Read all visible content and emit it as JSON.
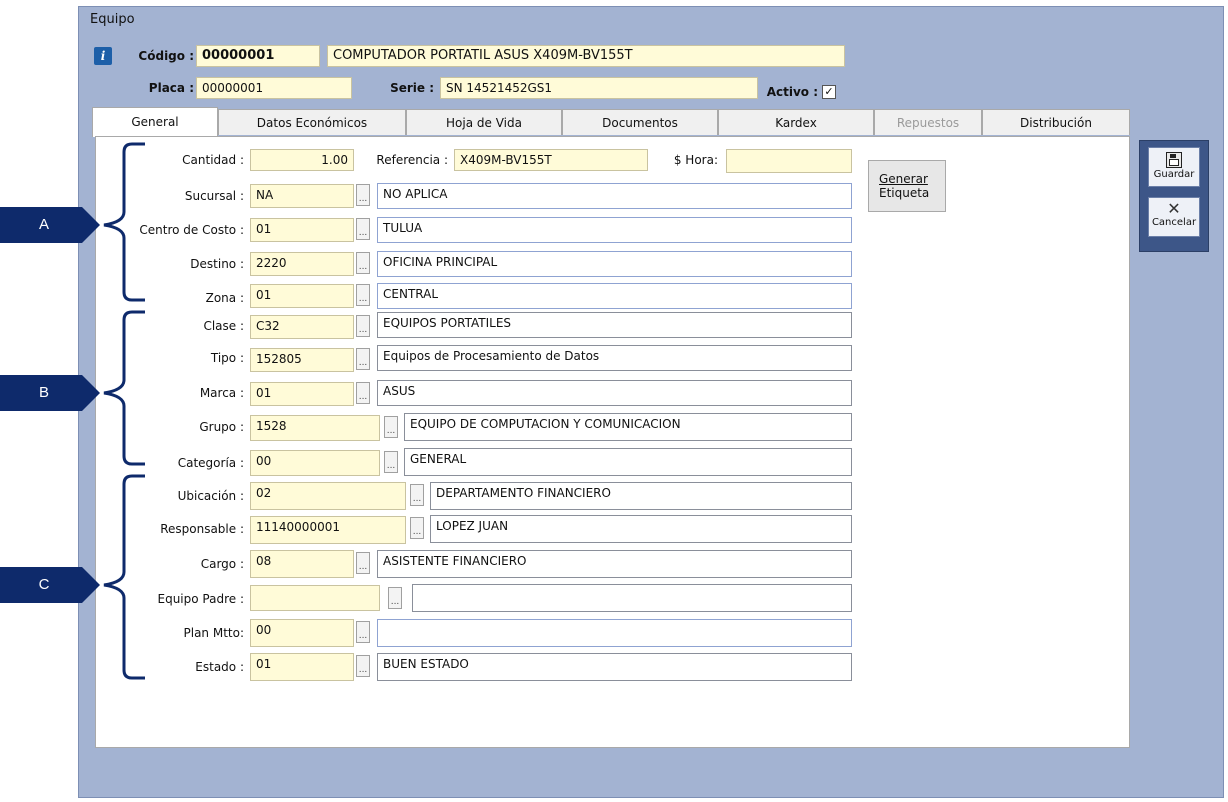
{
  "window": {
    "title": "Equipo"
  },
  "header": {
    "codigo_label": "Código :",
    "codigo_value": "00000001",
    "descripcion": "COMPUTADOR PORTATIL ASUS X409M-BV155T",
    "placa_label": "Placa :",
    "placa_value": "00000001",
    "serie_label": "Serie :",
    "serie_value": "SN 14521452GS1",
    "activo_label": "Activo :",
    "activo_checked": true
  },
  "tabs": [
    {
      "label": "General"
    },
    {
      "label": "Datos Económicos"
    },
    {
      "label": "Hoja de Vida"
    },
    {
      "label": "Documentos"
    },
    {
      "label": "Kardex"
    },
    {
      "label": "Repuestos"
    },
    {
      "label": "Distribución"
    }
  ],
  "general": {
    "cantidad_label": "Cantidad :",
    "cantidad_value": "1.00",
    "referencia_label": "Referencia :",
    "referencia_value": "X409M-BV155T",
    "hora_label": "$ Hora:",
    "hora_value": "",
    "generar_line1": "Generar",
    "generar_line2": "Etiqueta",
    "rows": [
      {
        "label": "Sucursal :",
        "code": "NA",
        "desc": "NO APLICA"
      },
      {
        "label": "Centro de Costo :",
        "code": "01",
        "desc": "TULUA"
      },
      {
        "label": "Destino :",
        "code": "2220",
        "desc": "OFICINA PRINCIPAL"
      },
      {
        "label": "Zona :",
        "code": "01",
        "desc": "CENTRAL"
      },
      {
        "label": "Clase :",
        "code": "C32",
        "desc": "EQUIPOS PORTATILES"
      },
      {
        "label": "Tipo :",
        "code": "152805",
        "desc": "Equipos de Procesamiento de Datos"
      },
      {
        "label": "Marca :",
        "code": "01",
        "desc": "ASUS"
      },
      {
        "label": "Grupo :",
        "code": "1528",
        "desc": "EQUIPO DE COMPUTACION Y COMUNICACION"
      },
      {
        "label": "Categoría :",
        "code": "00",
        "desc": "GENERAL"
      },
      {
        "label": "Ubicación :",
        "code": "02",
        "desc": "DEPARTAMENTO FINANCIERO"
      },
      {
        "label": "Responsable :",
        "code": "11140000001",
        "desc": "LOPEZ JUAN"
      },
      {
        "label": "Cargo :",
        "code": "08",
        "desc": "ASISTENTE FINANCIERO"
      },
      {
        "label": "Equipo Padre :",
        "code": "",
        "desc": ""
      },
      {
        "label": "Plan Mtto:",
        "code": "00",
        "desc": ""
      },
      {
        "label": "Estado :",
        "code": "01",
        "desc": "BUEN ESTADO"
      }
    ]
  },
  "side": {
    "guardar": "Guardar",
    "cancelar": "Cancelar"
  },
  "markers": [
    "A",
    "B",
    "C"
  ],
  "colors": {
    "field_bg": "#fffbd8",
    "window_bg": "#a3b3d2",
    "marker_bg": "#0e2a6b"
  }
}
